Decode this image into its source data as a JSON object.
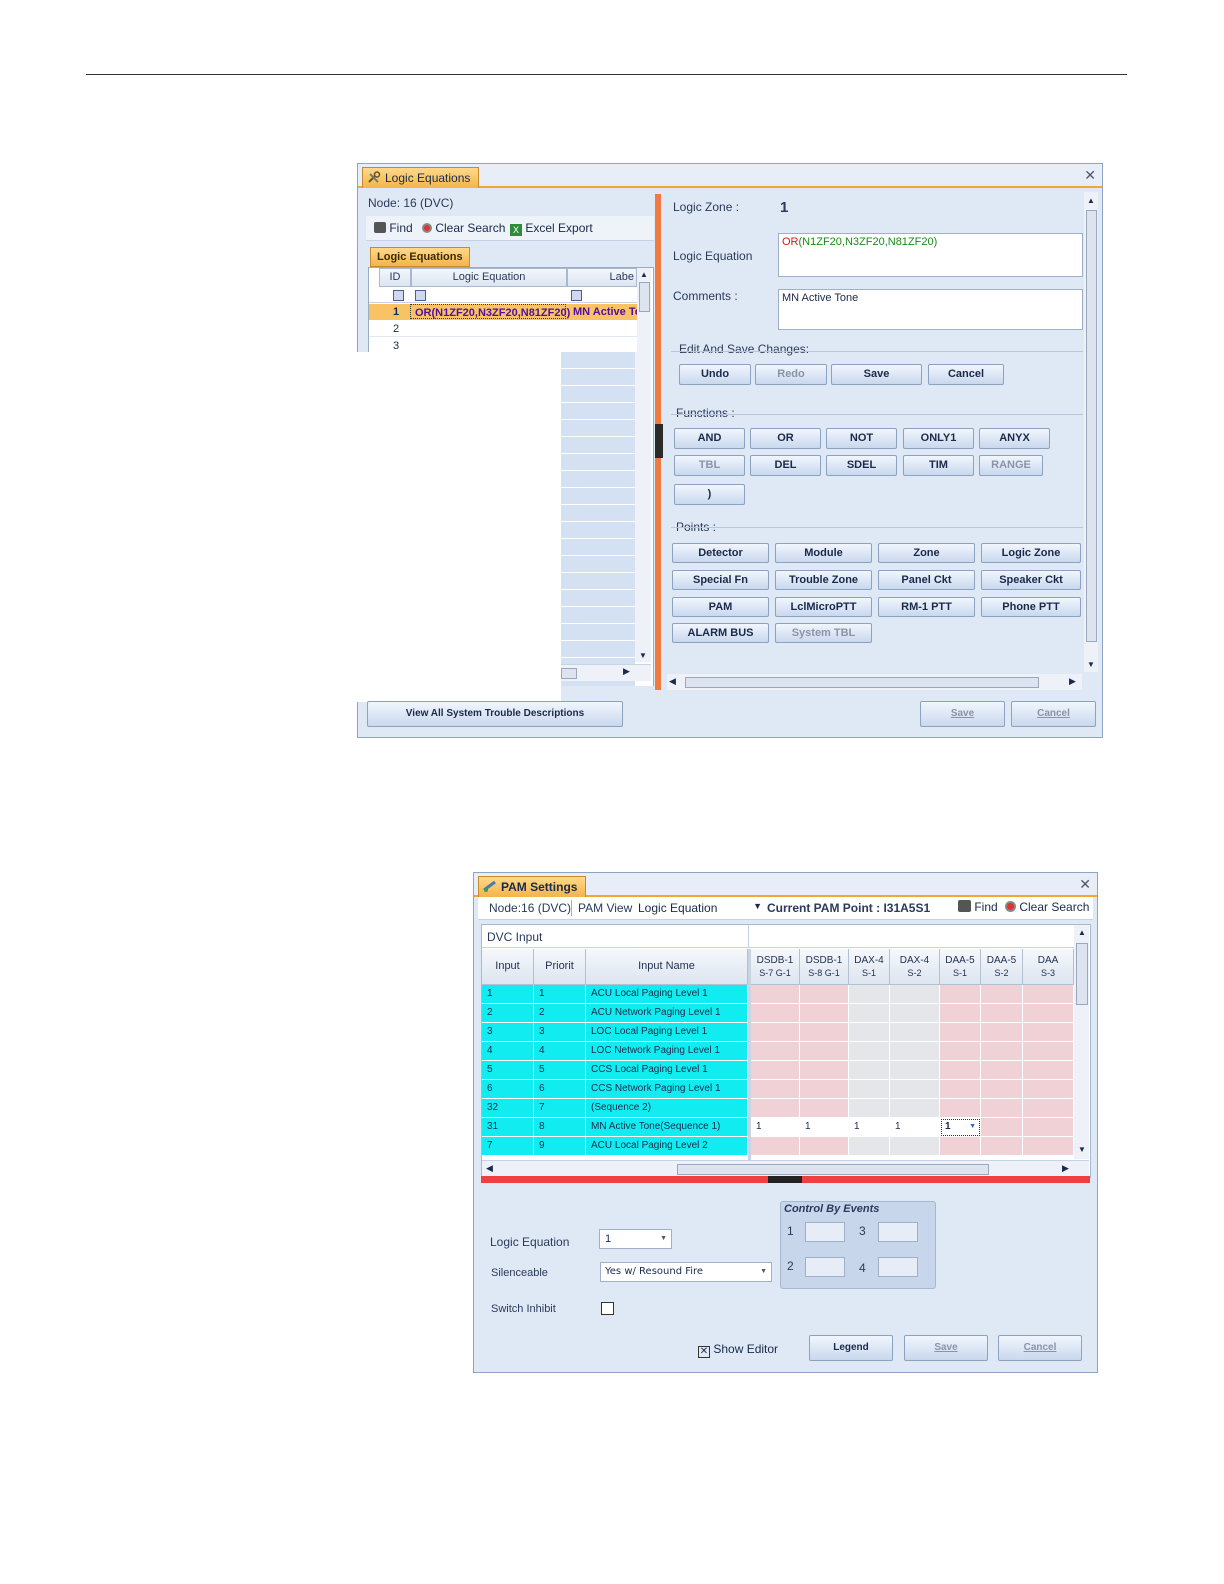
{
  "logic_window": {
    "tab_title": "Logic Equations",
    "node": "Node: 16 (DVC)",
    "toolbar": {
      "find": "Find",
      "clear_search": "Clear Search",
      "excel_export": "Excel Export"
    },
    "inner_tab": "Logic Equations",
    "grid": {
      "columns": [
        "ID",
        "Logic Equation",
        "Labe"
      ],
      "rows": [
        {
          "id": "1",
          "equation": "OR(N1ZF20,N3ZF20,N81ZF20)",
          "label": "MN Active To"
        },
        {
          "id": "2",
          "equation": "",
          "label": ""
        },
        {
          "id": "3",
          "equation": "",
          "label": ""
        }
      ]
    },
    "editor": {
      "logic_zone_label": "Logic Zone :",
      "logic_zone_value": "1",
      "logic_equation_label": "Logic Equation",
      "equation_fn": "OR",
      "equation_args": "(N1ZF20,N3ZF20,N81ZF20)",
      "comments_label": "Comments :",
      "comments_value": "MN Active Tone",
      "edit_group": "Edit And Save Changes:",
      "edit_buttons": [
        "Undo",
        "Redo",
        "Save",
        "Cancel"
      ],
      "functions_group": "Functions :",
      "functions": [
        "AND",
        "OR",
        "NOT",
        "ONLY1",
        "ANYX",
        "TBL",
        "DEL",
        "SDEL",
        "TIM",
        "RANGE",
        ")"
      ],
      "points_group": "Points :",
      "points": [
        "Detector",
        "Module",
        "Zone",
        "Logic Zone",
        "Special Fn",
        "Trouble Zone",
        "Panel Ckt",
        "Speaker Ckt",
        "PAM",
        "LclMicroPTT",
        "RM-1 PTT",
        "Phone PTT",
        "ALARM BUS",
        "System TBL"
      ]
    },
    "footer": {
      "view_all": "View All System Trouble Descriptions",
      "save": "Save",
      "cancel": "Cancel"
    }
  },
  "pam_window": {
    "tab_title": "PAM Settings",
    "node": "Node:16 (DVC)",
    "pam_view_label": "PAM View",
    "pam_view_value": "Logic Equation",
    "current_point": "Current PAM Point : I31A5S1",
    "find": "Find",
    "clear_search": "Clear Search",
    "section": "DVC Input",
    "columns": [
      "Input",
      "Priorit",
      "Input Name"
    ],
    "device_columns": [
      {
        "top": "DSDB-1",
        "bottom": "S-7 G-1"
      },
      {
        "top": "DSDB-1",
        "bottom": "S-8 G-1"
      },
      {
        "top": "DAX-4",
        "bottom": "S-1"
      },
      {
        "top": "DAX-4",
        "bottom": "S-2"
      },
      {
        "top": "DAA-5",
        "bottom": "S-1"
      },
      {
        "top": "DAA-5",
        "bottom": "S-2"
      },
      {
        "top": "DAA",
        "bottom": "S-3"
      }
    ],
    "rows": [
      {
        "input": "1",
        "priority": "1",
        "name": "ACU Local Paging Level 1",
        "vals": [
          "",
          "",
          "",
          "",
          "",
          "",
          ""
        ]
      },
      {
        "input": "2",
        "priority": "2",
        "name": "ACU Network Paging Level 1",
        "vals": [
          "",
          "",
          "",
          "",
          "",
          "",
          ""
        ]
      },
      {
        "input": "3",
        "priority": "3",
        "name": "LOC Local Paging Level 1",
        "vals": [
          "",
          "",
          "",
          "",
          "",
          "",
          ""
        ]
      },
      {
        "input": "4",
        "priority": "4",
        "name": "LOC Network Paging Level 1",
        "vals": [
          "",
          "",
          "",
          "",
          "",
          "",
          ""
        ]
      },
      {
        "input": "5",
        "priority": "5",
        "name": "CCS Local Paging Level 1",
        "vals": [
          "",
          "",
          "",
          "",
          "",
          "",
          ""
        ]
      },
      {
        "input": "6",
        "priority": "6",
        "name": "CCS Network Paging Level 1",
        "vals": [
          "",
          "",
          "",
          "",
          "",
          "",
          ""
        ]
      },
      {
        "input": "32",
        "priority": "7",
        "name": "(Sequence 2)",
        "vals": [
          "",
          "",
          "",
          "",
          "",
          "",
          ""
        ]
      },
      {
        "input": "31",
        "priority": "8",
        "name": "MN Active Tone(Sequence 1)",
        "vals": [
          "1",
          "1",
          "1",
          "1",
          "1",
          "",
          ""
        ]
      },
      {
        "input": "7",
        "priority": "9",
        "name": "ACU Local Paging Level 2",
        "vals": [
          "",
          "",
          "",
          "",
          "",
          "",
          ""
        ]
      }
    ],
    "form": {
      "logic_equation_label": "Logic Equation",
      "logic_equation_value": "1",
      "silenceable_label": "Silenceable",
      "silenceable_value": "Yes w/ Resound Fire",
      "switch_inhibit_label": "Switch Inhibit",
      "control_by_events": "Control By Events",
      "cbe_slots": [
        "1",
        "3",
        "2",
        "4"
      ],
      "show_editor": "Show Editor",
      "legend": "Legend",
      "save": "Save",
      "cancel": "Cancel"
    }
  }
}
